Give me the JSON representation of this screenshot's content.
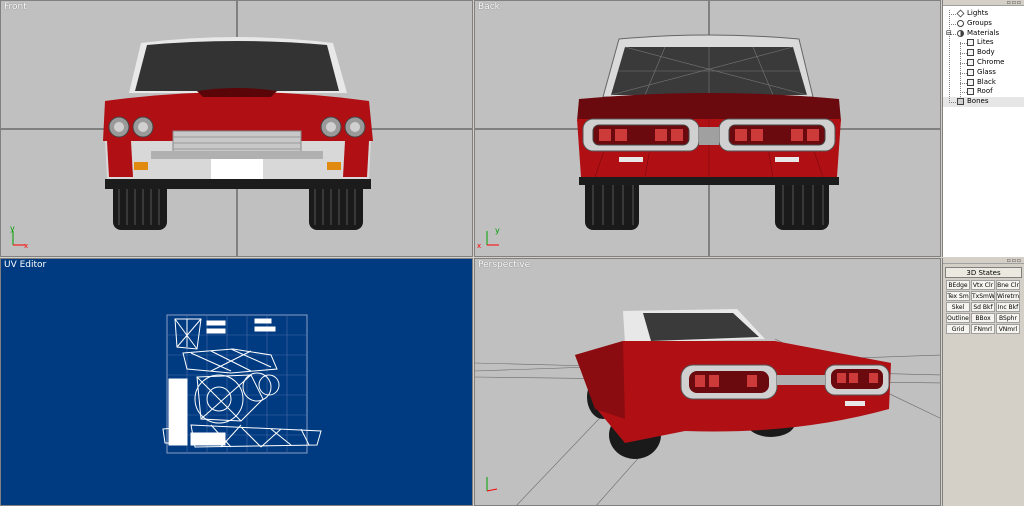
{
  "viewports": {
    "front": {
      "title": "Front"
    },
    "back": {
      "title": "Back"
    },
    "uv": {
      "title": "UV Editor"
    },
    "perspective": {
      "title": "Perspective"
    }
  },
  "axes": {
    "y": "y",
    "x": "x"
  },
  "tree": {
    "items": [
      {
        "label": "Lights",
        "icon": "light-icon"
      },
      {
        "label": "Groups",
        "icon": "group-icon"
      },
      {
        "label": "Materials",
        "icon": "materials-icon"
      },
      {
        "label": "Lites",
        "icon": "material-icon"
      },
      {
        "label": "Body",
        "icon": "material-icon"
      },
      {
        "label": "Chrome",
        "icon": "material-icon"
      },
      {
        "label": "Glass",
        "icon": "material-icon"
      },
      {
        "label": "Black",
        "icon": "material-icon"
      },
      {
        "label": "Roof",
        "icon": "material-icon"
      },
      {
        "label": "Bones",
        "icon": "bones-icon"
      }
    ]
  },
  "states": {
    "title": "3D States",
    "buttons": [
      "BEdge",
      "Vtx Clr",
      "Bne Clr",
      "Tex Sm",
      "TxSmWr",
      "Wiretrne",
      "Skel",
      "Sd Bkf",
      "Inc Bkf",
      "Outline",
      "BBox",
      "BSphr",
      "Grid",
      "FNmrl",
      "VNmrl"
    ]
  },
  "colors": {
    "body": "#b00f14",
    "uv_bg": "#003a80",
    "viewport_bg": "#c0c0c0"
  }
}
